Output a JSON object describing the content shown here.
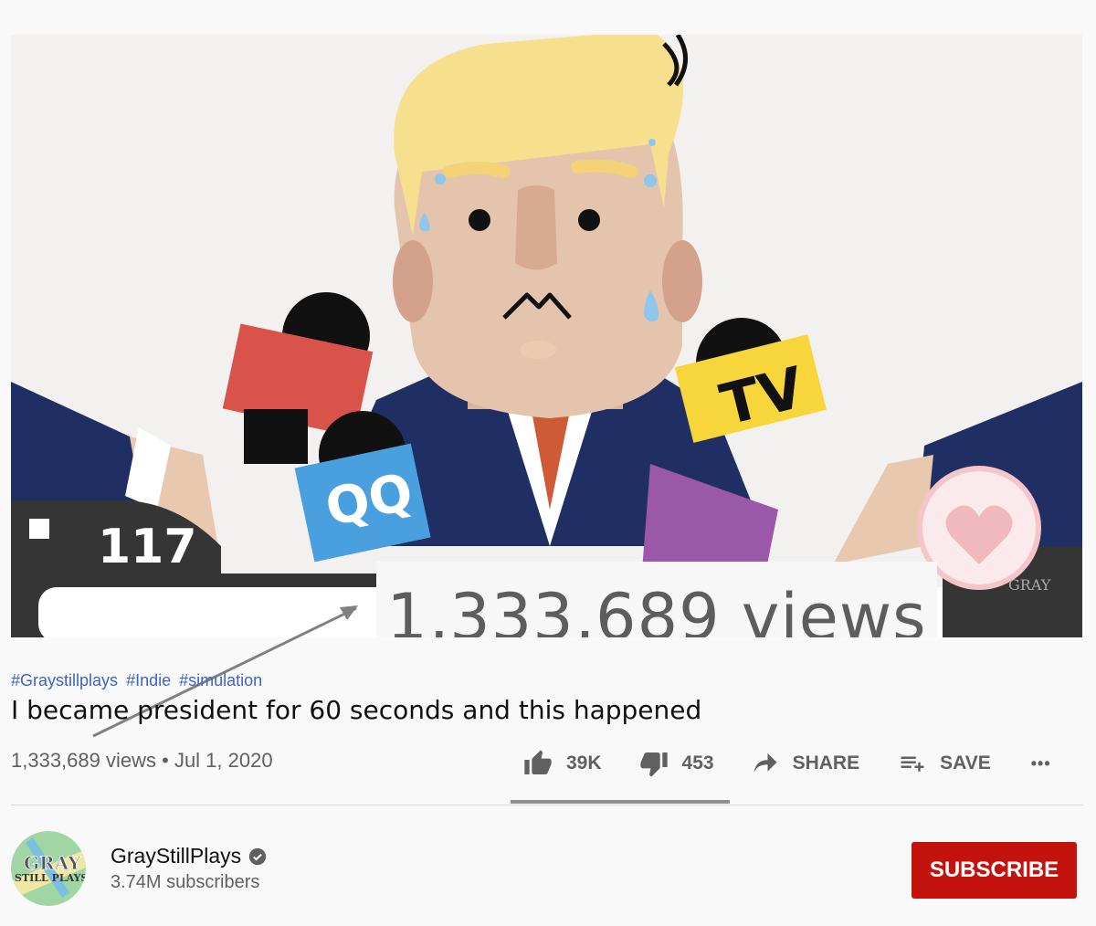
{
  "video": {
    "overlay_counter": "117",
    "thumbnail_labels": {
      "mic1": "QQ",
      "mic2": "TV"
    },
    "watermark": "GRAY STILLPLAYS",
    "zoom_callout": "1,333,689 views"
  },
  "hashtags": [
    "#Graystillplays",
    "#Indie",
    "#simulation"
  ],
  "title": "I became president for 60 seconds and this happened",
  "meta": {
    "views": "1,333,689 views",
    "separator": " • ",
    "date": "Jul 1, 2020"
  },
  "actions": {
    "likes": "39K",
    "dislikes": "453",
    "share": "SHARE",
    "save": "SAVE",
    "more": "•••"
  },
  "channel": {
    "name": "GrayStillPlays",
    "subscribers": "3.74M subscribers",
    "avatar_text": "GRAY STILL PLAYS"
  },
  "subscribe": "SUBSCRIBE",
  "colors": {
    "accent": "#c4130c",
    "hashtag": "#3e65c4",
    "meta": "#606060"
  }
}
